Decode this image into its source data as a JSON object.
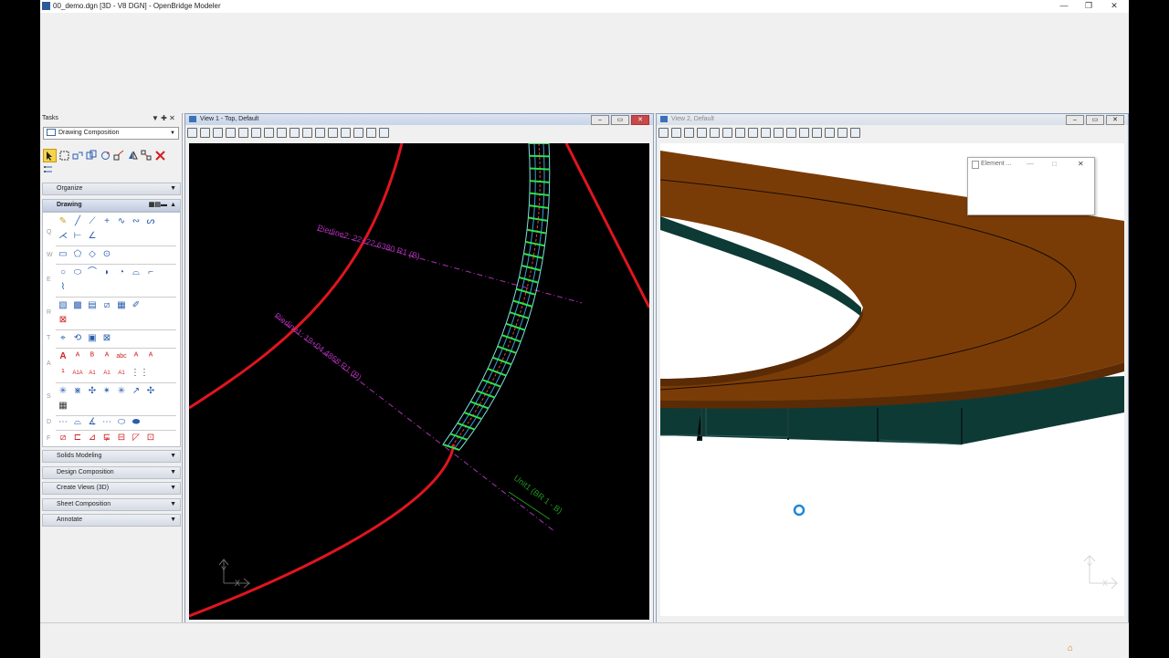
{
  "window": {
    "title": "00_demo.dgn [3D - V8 DGN] - OpenBridge Modeler",
    "minimize": "—",
    "restore": "❐",
    "close": "✕"
  },
  "tasks": {
    "title": "Tasks",
    "pin": "▼ ✚ ✕",
    "workflow": "Drawing Composition",
    "sections": {
      "organize": "Organize",
      "drawing": "Drawing",
      "solids": "Solids Modeling",
      "design": "Design Composition",
      "views3d": "Create Views (3D)",
      "sheet": "Sheet Composition",
      "annotate": "Annotate"
    },
    "group_keys": [
      "Q",
      "W",
      "E",
      "R",
      "T",
      "A",
      "S",
      "D",
      "F"
    ]
  },
  "view1": {
    "title": "View 1 - Top, Default",
    "labels": {
      "pierline2": "Pierline2: 22+22.6380 R1 (B)",
      "pierline1": "Pierline1: 19+04.4868 R1 (B)",
      "unit": "Unit1 (BR 1 - B)"
    },
    "axis_y": "Y",
    "axis_x": "X"
  },
  "view2": {
    "title": "View 2, Default",
    "axis_y": "Y",
    "axis_x": "X"
  },
  "element_window": {
    "title": "Element ..."
  },
  "colors": {
    "alignment": "#e0151f",
    "pierline": "#b030b8",
    "girders_top": "#2fe04a",
    "deck": "#7a3c07",
    "girder_3d": "#0e3a36"
  }
}
